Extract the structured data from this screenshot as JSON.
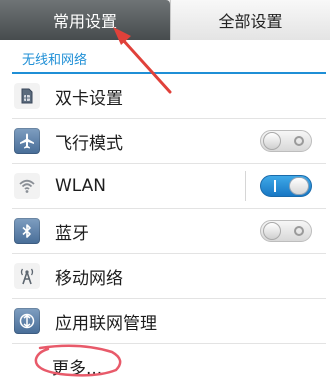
{
  "tabs": [
    {
      "label": "常用设置",
      "active": true
    },
    {
      "label": "全部设置",
      "active": false
    }
  ],
  "section": {
    "title": "无线和网络"
  },
  "items": [
    {
      "label": "双卡设置",
      "icon": "sim-card-icon"
    },
    {
      "label": "飞行模式",
      "icon": "airplane-icon",
      "toggle": "off"
    },
    {
      "label": "WLAN",
      "icon": "wifi-icon",
      "toggle": "on"
    },
    {
      "label": "蓝牙",
      "icon": "bluetooth-icon",
      "toggle": "off"
    },
    {
      "label": "移动网络",
      "icon": "signal-tower-icon"
    },
    {
      "label": "应用联网管理",
      "icon": "network-app-icon"
    }
  ],
  "more": {
    "label": "更多..."
  },
  "colors": {
    "accent": "#1f8fd6",
    "annotation": "#e0413a"
  }
}
